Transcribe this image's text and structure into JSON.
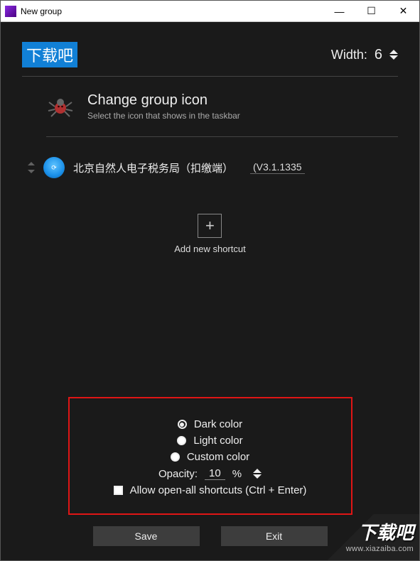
{
  "titlebar": {
    "title": "New group"
  },
  "group_name": "下载吧",
  "width": {
    "label": "Width:",
    "value": "6"
  },
  "change_icon": {
    "title": "Change group icon",
    "subtitle": "Select the icon that shows in the taskbar"
  },
  "shortcut": {
    "name": "北京自然人电子税务局（扣缴端）",
    "version": "(V3.1.1335"
  },
  "add": {
    "label": "Add new shortcut"
  },
  "advanced": {
    "radios": {
      "dark": "Dark color",
      "light": "Light color",
      "custom": "Custom color"
    },
    "opacity_label": "Opacity:",
    "opacity_value": "10",
    "opacity_unit": "%",
    "allow_open_all": "Allow open-all shortcuts (Ctrl + Enter)"
  },
  "buttons": {
    "save": "Save",
    "exit": "Exit"
  },
  "watermark": {
    "big": "下载吧",
    "url": "www.xiazaiba.com"
  }
}
